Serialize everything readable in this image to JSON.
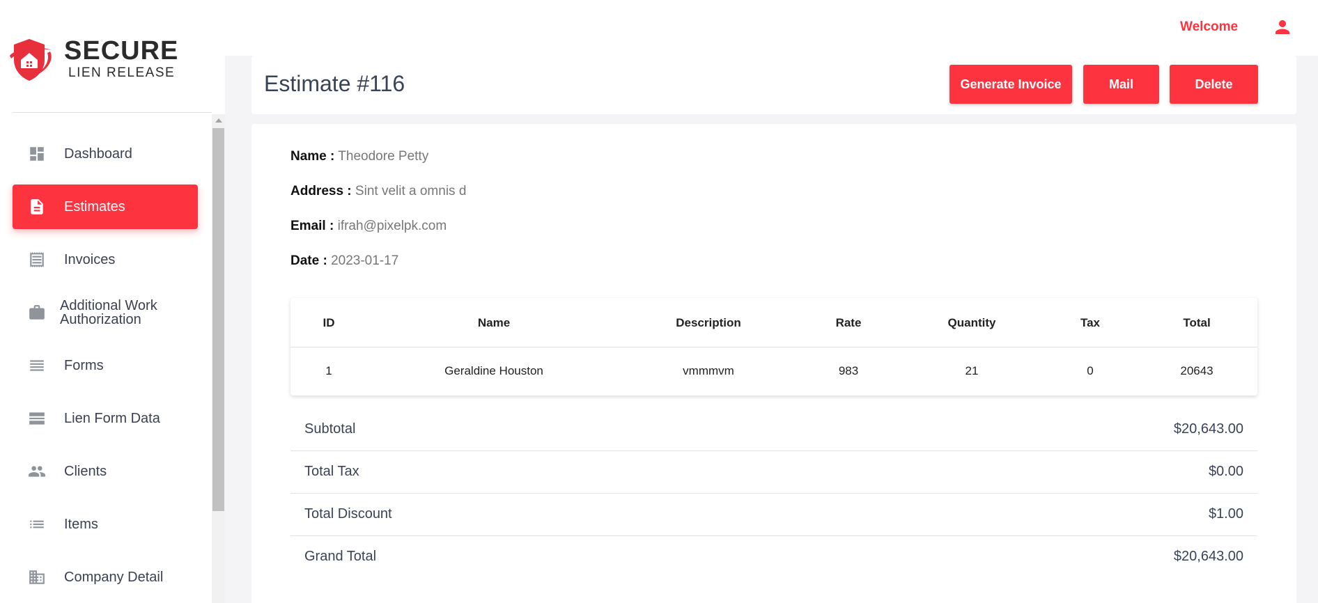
{
  "brand": {
    "name_top": "SECURE",
    "name_bottom": "LIEN RELEASE",
    "logo_color": "#e8303d"
  },
  "topbar": {
    "welcome": "Welcome",
    "user_icon": "account-icon"
  },
  "sidebar": {
    "items": [
      {
        "label": "Dashboard",
        "icon": "dashboard-icon",
        "active": false
      },
      {
        "label": "Estimates",
        "icon": "document-icon",
        "active": true
      },
      {
        "label": "Invoices",
        "icon": "receipt-icon",
        "active": false
      },
      {
        "label": "Additional Work\nAuthorization",
        "icon": "briefcase-icon",
        "active": false
      },
      {
        "label": "Forms",
        "icon": "list-lines-icon",
        "active": false
      },
      {
        "label": "Lien Form Data",
        "icon": "storage-icon",
        "active": false
      },
      {
        "label": "Clients",
        "icon": "people-icon",
        "active": false
      },
      {
        "label": "Items",
        "icon": "list-icon",
        "active": false
      },
      {
        "label": "Company Detail",
        "icon": "building-icon",
        "active": false
      }
    ]
  },
  "header": {
    "title": "Estimate #116",
    "buttons": {
      "generate_invoice": "Generate Invoice",
      "mail": "Mail",
      "delete": "Delete"
    }
  },
  "customer": {
    "name_label": "Name :",
    "name": "Theodore Petty",
    "address_label": "Address :",
    "address": "Sint velit a omnis d",
    "email_label": "Email :",
    "email": "ifrah@pixelpk.com",
    "date_label": "Date :",
    "date": "2023-01-17"
  },
  "table": {
    "columns": [
      "ID",
      "Name",
      "Description",
      "Rate",
      "Quantity",
      "Tax",
      "Total"
    ],
    "rows": [
      [
        "1",
        "Geraldine Houston",
        "vmmmvm",
        "983",
        "21",
        "0",
        "20643"
      ]
    ]
  },
  "summary": {
    "subtotal_label": "Subtotal",
    "subtotal": "$20,643.00",
    "tax_label": "Total Tax",
    "tax": "$0.00",
    "discount_label": "Total Discount",
    "discount": "$1.00",
    "grand_label": "Grand Total",
    "grand": "$20,643.00"
  },
  "colors": {
    "accent": "#fd3340",
    "text_dark": "#3a4356",
    "icon_gray": "#8f939a",
    "page_bg": "#f4f4f6"
  }
}
